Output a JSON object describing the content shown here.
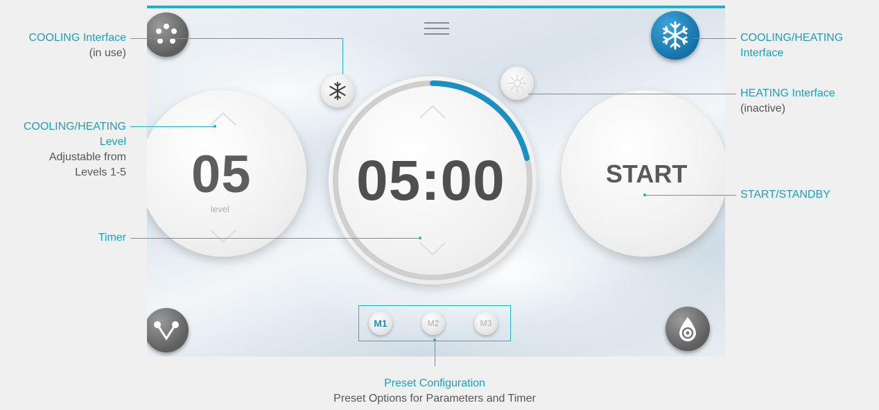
{
  "timer": {
    "value": "05:00"
  },
  "level": {
    "value": "05",
    "sub": "level"
  },
  "start": {
    "label": "START"
  },
  "presets": [
    {
      "label": "M1",
      "active": true
    },
    {
      "label": "M2",
      "active": false
    },
    {
      "label": "M3",
      "active": false
    }
  ],
  "annotations": {
    "cooling_interface": {
      "title": "COOLING Interface",
      "sub": "(in use)"
    },
    "cooling_heating_level": {
      "title1": "COOLING/HEATING",
      "title2": "Level",
      "sub1": "Adjustable from",
      "sub2": "Levels 1-5"
    },
    "timer": {
      "title": "Timer"
    },
    "cooling_heating_interface": {
      "title1": "COOLING/HEATING",
      "title2": "Interface"
    },
    "heating_interface": {
      "title": "HEATING Interface",
      "sub": "(inactive)"
    },
    "start_standby": {
      "title": "START/STANDBY"
    },
    "preset_configuration": {
      "title": "Preset Configuration",
      "sub": "Preset Options for Parameters and Timer"
    }
  },
  "colors": {
    "accent": "#1db3c9",
    "progress": "#1a8fc2",
    "active_button": "#1a8fc2"
  },
  "icons": [
    "dots-icon",
    "menu-icon",
    "snowflake-icon",
    "sun-icon",
    "vector-icon",
    "droplet-icon",
    "chevron-up-icon",
    "chevron-down-icon"
  ]
}
